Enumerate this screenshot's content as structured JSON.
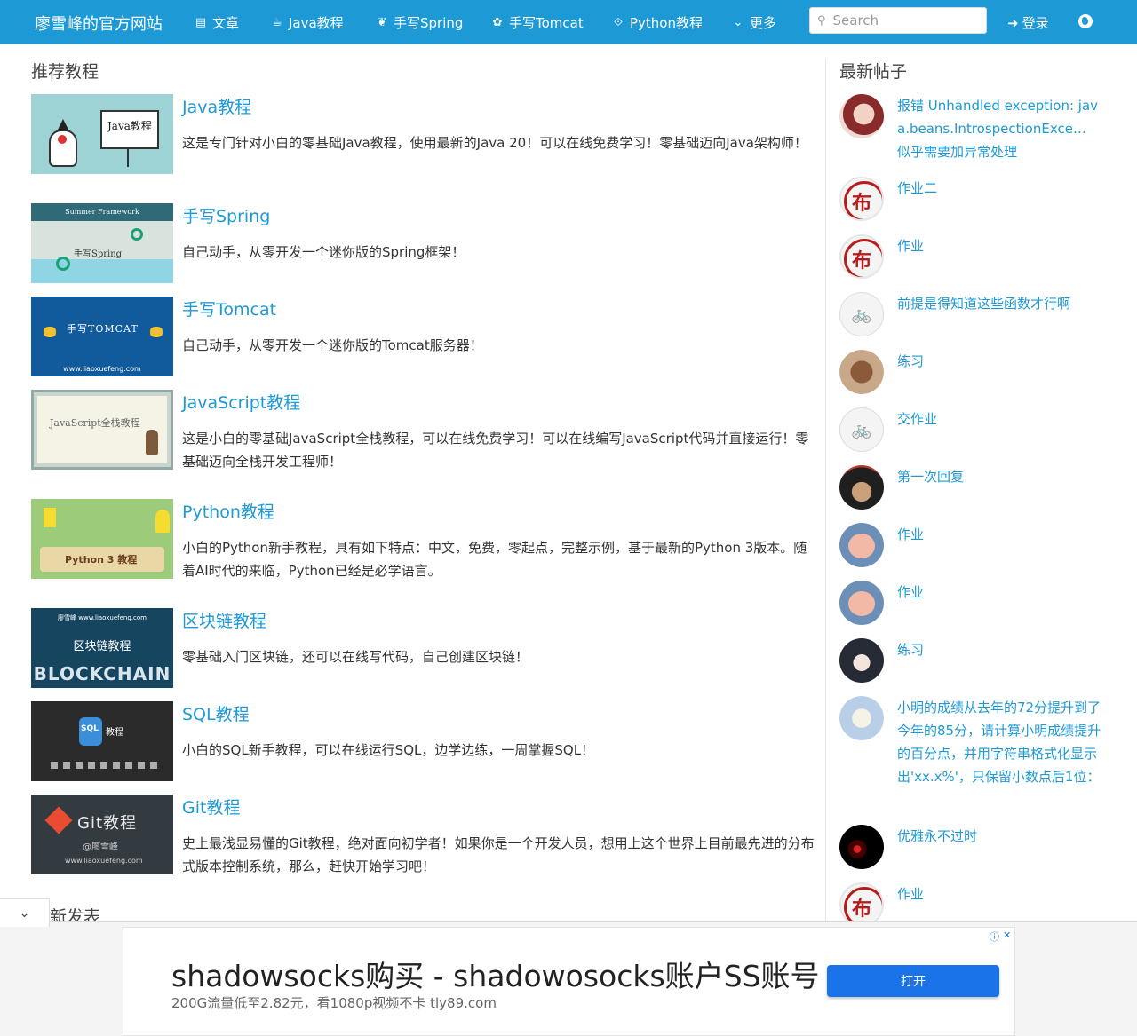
{
  "nav": {
    "brand": "廖雪峰的官方网站",
    "items": [
      {
        "label": "文章",
        "icon": "▤"
      },
      {
        "label": "Java教程",
        "icon": "☕"
      },
      {
        "label": "手写Spring",
        "icon": "❦"
      },
      {
        "label": "手写Tomcat",
        "icon": "✿"
      },
      {
        "label": "Python教程",
        "icon": "⟐"
      },
      {
        "label": "更多",
        "icon": "⌄"
      }
    ],
    "search_placeholder": "Search",
    "login": "登录"
  },
  "main": {
    "section_title": "推荐教程",
    "courses": [
      {
        "title": "Java教程",
        "desc": "这是专门针对小白的零基础Java教程，使用最新的Java 20！可以在线免费学习！零基础迈向Java架构师！",
        "thumb_text": "Java教程"
      },
      {
        "title": "手写Spring",
        "desc": "自己动手，从零开发一个迷你版的Spring框架！",
        "thumb_text": "手写Spring",
        "thumb_top": "Summer Framework"
      },
      {
        "title": "手写Tomcat",
        "desc": "自己动手，从零开发一个迷你版的Tomcat服务器！",
        "thumb_text": "手写TOMCAT",
        "thumb_bottom": "www.liaoxuefeng.com"
      },
      {
        "title": "JavaScript教程",
        "desc": "这是小白的零基础JavaScript全栈教程，可以在线免费学习！可以在线编写JavaScript代码并直接运行！零基础迈向全栈开发工程师！",
        "thumb_text": "JavaScript全栈教程"
      },
      {
        "title": "Python教程",
        "desc": "小白的Python新手教程，具有如下特点：中文，免费，零起点，完整示例，基于最新的Python 3版本。随着AI时代的来临，Python已经是必学语言。",
        "thumb_text": "Python 3 教程"
      },
      {
        "title": "区块链教程",
        "desc": "零基础入门区块链，还可以在线写代码，自己创建区块链！",
        "thumb_top": "廖雪峰 www.liaoxuefeng.com",
        "thumb_text": "区块链教程",
        "thumb_bottom": "BLOCKCHAIN"
      },
      {
        "title": "SQL教程",
        "desc": "小白的SQL新手教程，可以在线运行SQL，边学边练，一周掌握SQL！",
        "thumb_text": "SQL",
        "thumb_sub": "教程"
      },
      {
        "title": "Git教程",
        "desc": "史上最浅显易懂的Git教程，绝对面向初学者！如果你是一个开发人员，想用上这个世界上目前最先进的分布式版本控制系统，那么，赶快开始学习吧！",
        "thumb_text": "Git教程",
        "thumb_sub": "@廖雪峰",
        "thumb_bottom": "www.liaoxuefeng.com"
      }
    ],
    "recent_title": "新发表"
  },
  "sidebar": {
    "title": "最新帖子",
    "posts": [
      {
        "title": "报错 Unhandled exception: java.beans.IntrospectionExce… 似乎需要加异常处理",
        "avatar": "anime1"
      },
      {
        "title": "作业二",
        "avatar": "bu"
      },
      {
        "title": "作业",
        "avatar": "bu"
      },
      {
        "title": "前提是得知道这些函数才行啊",
        "avatar": "bike"
      },
      {
        "title": "练习",
        "avatar": "bat"
      },
      {
        "title": "交作业",
        "avatar": "bike"
      },
      {
        "title": "第一次回复",
        "avatar": "man"
      },
      {
        "title": "作业",
        "avatar": "pig"
      },
      {
        "title": "作业",
        "avatar": "pig"
      },
      {
        "title": "练习",
        "avatar": "anime2"
      },
      {
        "title": "小明的成绩从去年的72分提升到了今年的85分，请计算小明成绩提升的百分点，并用字符串格式化显示出'xx.x%'，只保留小数点后1位：",
        "avatar": "anime3"
      },
      {
        "title": "优雅永不过时",
        "avatar": "dark"
      },
      {
        "title": "作业",
        "avatar": "bu"
      }
    ],
    "bu_char": "布",
    "bike_char": "🚲"
  },
  "ad": {
    "title": "shadowsocks购买 - shadowosocks账户SS账号",
    "subtitle": "200G流量低至2.82元，看1080p视频不卡 tly89.com",
    "button": "打开",
    "info_icon": "ⓘ",
    "close_icon": "✕"
  },
  "colors": {
    "nav_bg": "#1d9ad6",
    "link": "#1d9ad6",
    "ad_button": "#1a73e8"
  }
}
